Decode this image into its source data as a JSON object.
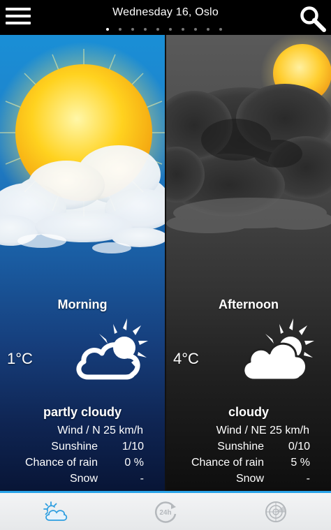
{
  "header": {
    "title": "Wednesday 16, Oslo",
    "page_count": 10,
    "active_page": 1
  },
  "morning": {
    "period": "Morning",
    "temperature": "1°C",
    "condition": "partly cloudy",
    "icon": "partly-cloudy-icon",
    "details": {
      "wind_label": "Wind / N",
      "wind_value": "25 km/h",
      "sunshine_label": "Sunshine",
      "sunshine_value": "1/10",
      "rain_label": "Chance of rain",
      "rain_value": "0 %",
      "snow_label": "Snow",
      "snow_value": "-"
    }
  },
  "afternoon": {
    "period": "Afternoon",
    "temperature": "4°C",
    "condition": "cloudy",
    "icon": "cloudy-icon",
    "details": {
      "wind_label": "Wind / NE",
      "wind_value": "25 km/h",
      "sunshine_label": "Sunshine",
      "sunshine_value": "0/10",
      "rain_label": "Chance of rain",
      "rain_value": "5 %",
      "snow_label": "Snow",
      "snow_value": "-"
    }
  },
  "tabs": [
    {
      "icon": "weather-today-icon"
    },
    {
      "icon": "24h-forecast-icon"
    },
    {
      "icon": "radar-icon"
    }
  ],
  "colors": {
    "accent": "#29a3e8",
    "morning_sky": "#1a8fd6",
    "afternoon_sky": "#5a5a5a"
  }
}
